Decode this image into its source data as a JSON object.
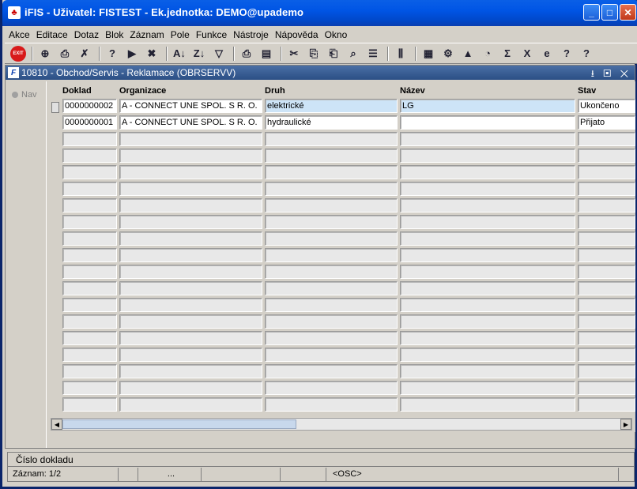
{
  "window": {
    "title": "iFIS - Uživatel: FISTEST - Ek.jednotka: DEMO@upademo",
    "btn_min": "_",
    "btn_max": "□",
    "btn_close": "✕"
  },
  "menu": [
    "Akce",
    "Editace",
    "Dotaz",
    "Blok",
    "Záznam",
    "Pole",
    "Funkce",
    "Nástroje",
    "Nápověda",
    "Okno"
  ],
  "toolbar": {
    "exit_label": "EXIT",
    "icons": [
      "add-record-icon",
      "print-icon",
      "delete-icon",
      "query-icon",
      "execute-query-icon",
      "cancel-query-icon",
      "sort-asc-icon",
      "sort-desc-icon",
      "filter-icon",
      "print-report-icon",
      "preview-icon",
      "cut-icon",
      "copy-icon",
      "paste-icon",
      "search-icon",
      "list-icon",
      "columns-icon",
      "calc-icon",
      "settings-icon",
      "chart-icon",
      "clock-icon",
      "sum-icon",
      "excel-icon",
      "web-icon",
      "help-pointer-icon",
      "help-icon"
    ],
    "glyphs": [
      "⊕",
      "⎙",
      "✗",
      "?",
      "▶",
      "✖",
      "A↓",
      "Z↓",
      "▽",
      "⎙",
      "▤",
      "✂",
      "⎘",
      "⎗",
      "⌕",
      "☰",
      "⫼",
      "▦",
      "⚙",
      "▲",
      "◔",
      "Σ",
      "X",
      "e",
      "?",
      "?"
    ]
  },
  "form": {
    "icon": "F",
    "title": "10810 - Obchod/Servis - Reklamace (OBRSERVV)",
    "controls": "⭳ ▣ ✕"
  },
  "nav": {
    "label": "Nav"
  },
  "columns": [
    {
      "label": "Doklad"
    },
    {
      "label": "Organizace"
    },
    {
      "label": "Druh"
    },
    {
      "label": "Název"
    },
    {
      "label": "Stav"
    }
  ],
  "rows": [
    {
      "doklad": "0000000002",
      "organizace": "A - CONNECT UNE SPOL. S R. O.",
      "druh": "elektrické",
      "nazev": "LG",
      "stav": "Ukončeno"
    },
    {
      "doklad": "0000000001",
      "organizace": "A - CONNECT UNE SPOL. S R. O.",
      "druh": "hydraulické",
      "nazev": "",
      "stav": "Přijato"
    }
  ],
  "empty_rows": 17,
  "status": {
    "hint": "Číslo dokladu",
    "record": "Záznam: 1/2",
    "dots": "...",
    "mode": "<OSC>"
  }
}
